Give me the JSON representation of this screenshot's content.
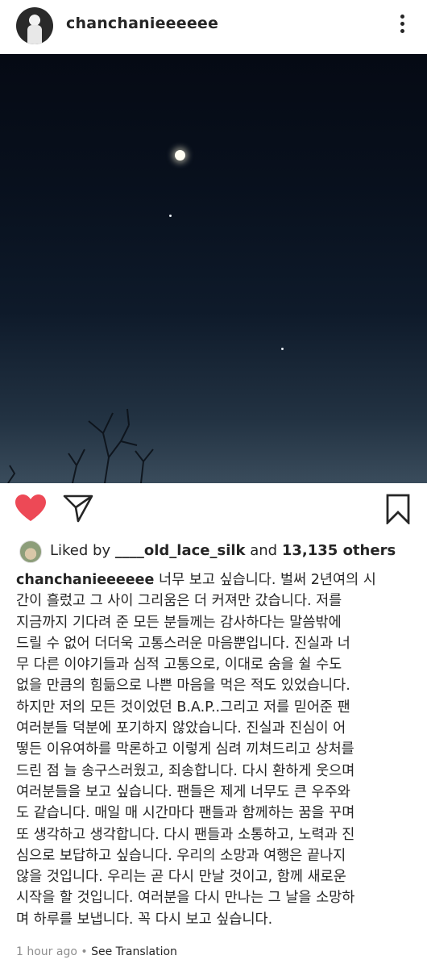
{
  "header": {
    "username": "chanchanieeeeee",
    "avatar_icon": "profile-avatar",
    "more_icon": "more-vertical-icon"
  },
  "post": {
    "image_description_icon": "night-sky-photo",
    "actions": {
      "like_icon": "heart-filled-icon",
      "share_icon": "send-paper-plane-icon",
      "save_icon": "bookmark-icon",
      "like_color": "#ed4956"
    }
  },
  "likes": {
    "prefix": "Liked by",
    "liker": "____old_lace_silk",
    "conjunction": "and",
    "others": "13,135 others"
  },
  "caption": {
    "username": "chanchanieeeeee",
    "lines": [
      " 너무 보고 싶습니다. 벌써 2년여의 시",
      "간이 흘렀고 그 사이 그리움은 더 커져만 갔습니다. 저를",
      "지금까지 기다려 준 모든 분들께는 감사하다는 말씀밖에",
      "드릴 수 없어 더더욱 고통스러운 마음뿐입니다. 진실과 너",
      "무 다른 이야기들과 심적 고통으로, 이대로 숨을 쉴 수도",
      "없을 만큼의 힘듦으로 나쁜 마음을 먹은 적도 있었습니다.",
      "하지만 저의 모든 것이었던 B.A.P..그리고 저를 믿어준 팬",
      "여러분들 덕분에 포기하지 않았습니다. 진실과 진심이 어",
      "떻든 이유여하를 막론하고 이렇게 심려 끼쳐드리고 상처를",
      "드린 점 늘 송구스러웠고, 죄송합니다. 다시 환하게 웃으며",
      "여러분들을 보고 싶습니다. 팬들은 제게 너무도 큰 우주와",
      "도 같습니다. 매일 매 시간마다 팬들과 함께하는 꿈을 꾸며",
      "또 생각하고 생각합니다. 다시 팬들과 소통하고, 노력과 진",
      "심으로 보답하고 싶습니다. 우리의 소망과 여행은 끝나지",
      "않을 것입니다. 우리는 곧 다시 만날 것이고, 함께 새로운",
      "시작을 할 것입니다. 여러분을 다시 만나는 그 날을 소망하",
      "며 하루를 보냅니다.  꼭 다시 보고 싶습니다."
    ]
  },
  "meta": {
    "time": "1 hour ago",
    "separator": " • ",
    "translate": "See Translation"
  }
}
